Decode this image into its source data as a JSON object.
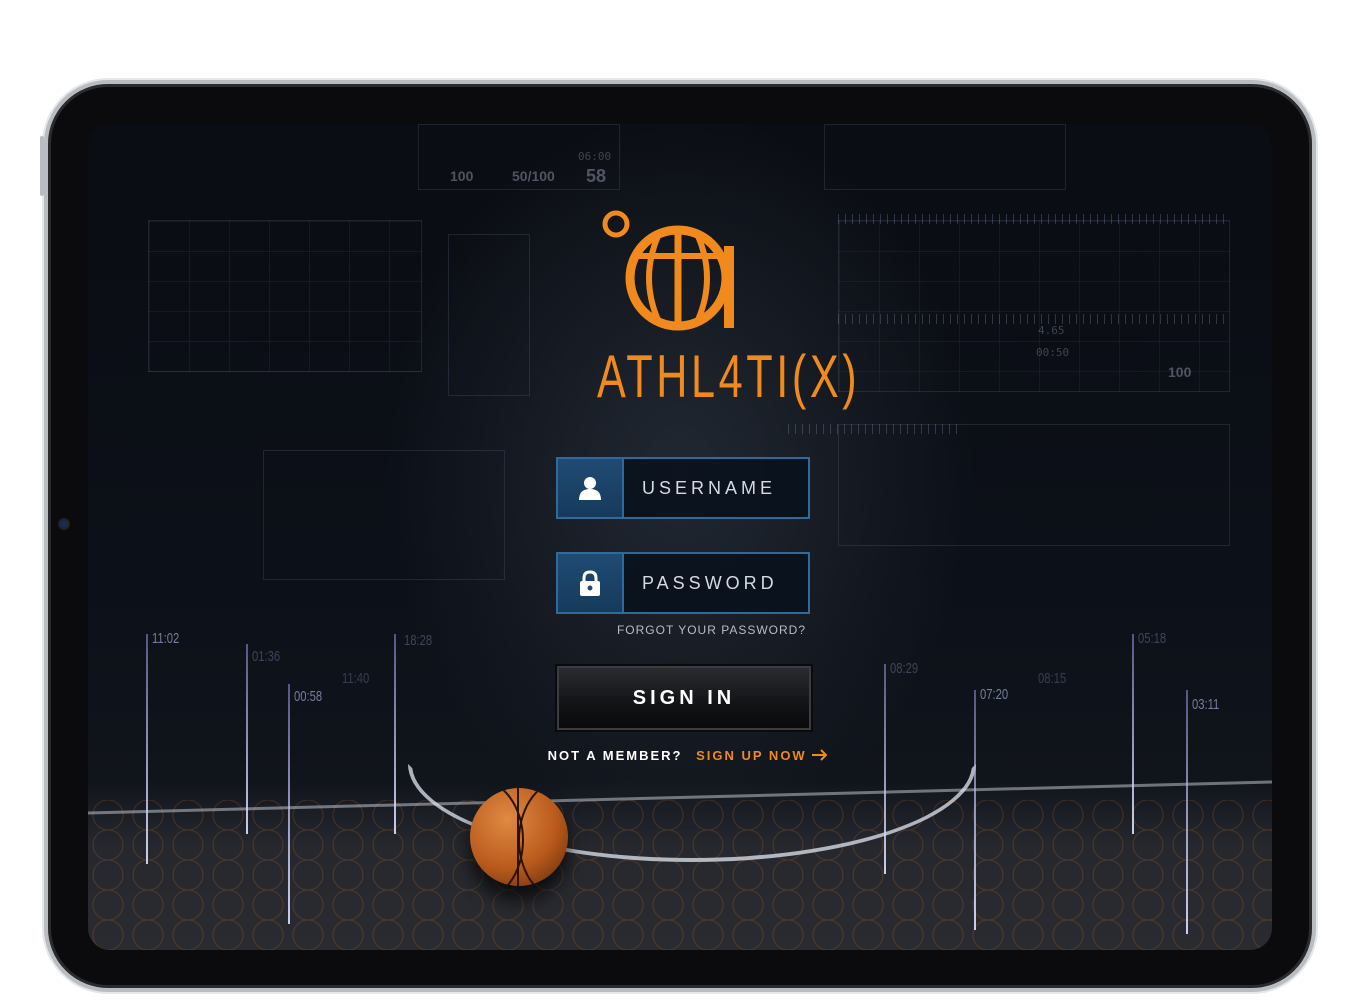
{
  "colors": {
    "accent": "#f08a1c",
    "field_border": "#2f6a9a",
    "field_icon_bg": "#1f4b73"
  },
  "brand": {
    "name": "ATHL4TI(X)",
    "logo_icon": "basketball-logo-icon"
  },
  "login": {
    "username_placeholder": "USERNAME",
    "username_icon": "user-icon",
    "password_placeholder": "PASSWORD",
    "password_icon": "lock-icon",
    "forgot_label": "FORGOT YOUR PASSWORD?",
    "signin_label": "SIGN IN",
    "member_question": "NOT A MEMBER?",
    "signup_label": "SIGN UP NOW",
    "signup_icon": "arrow-right-icon"
  },
  "background": {
    "timers": [
      "11:02",
      "01:36",
      "00:58",
      "11:40",
      "18:28",
      "08:29",
      "07:20",
      "08:15",
      "05:18",
      "03:11"
    ],
    "stats": [
      "100",
      "50/100",
      "58",
      "06:00",
      "4.65",
      "100",
      "00:50"
    ]
  }
}
